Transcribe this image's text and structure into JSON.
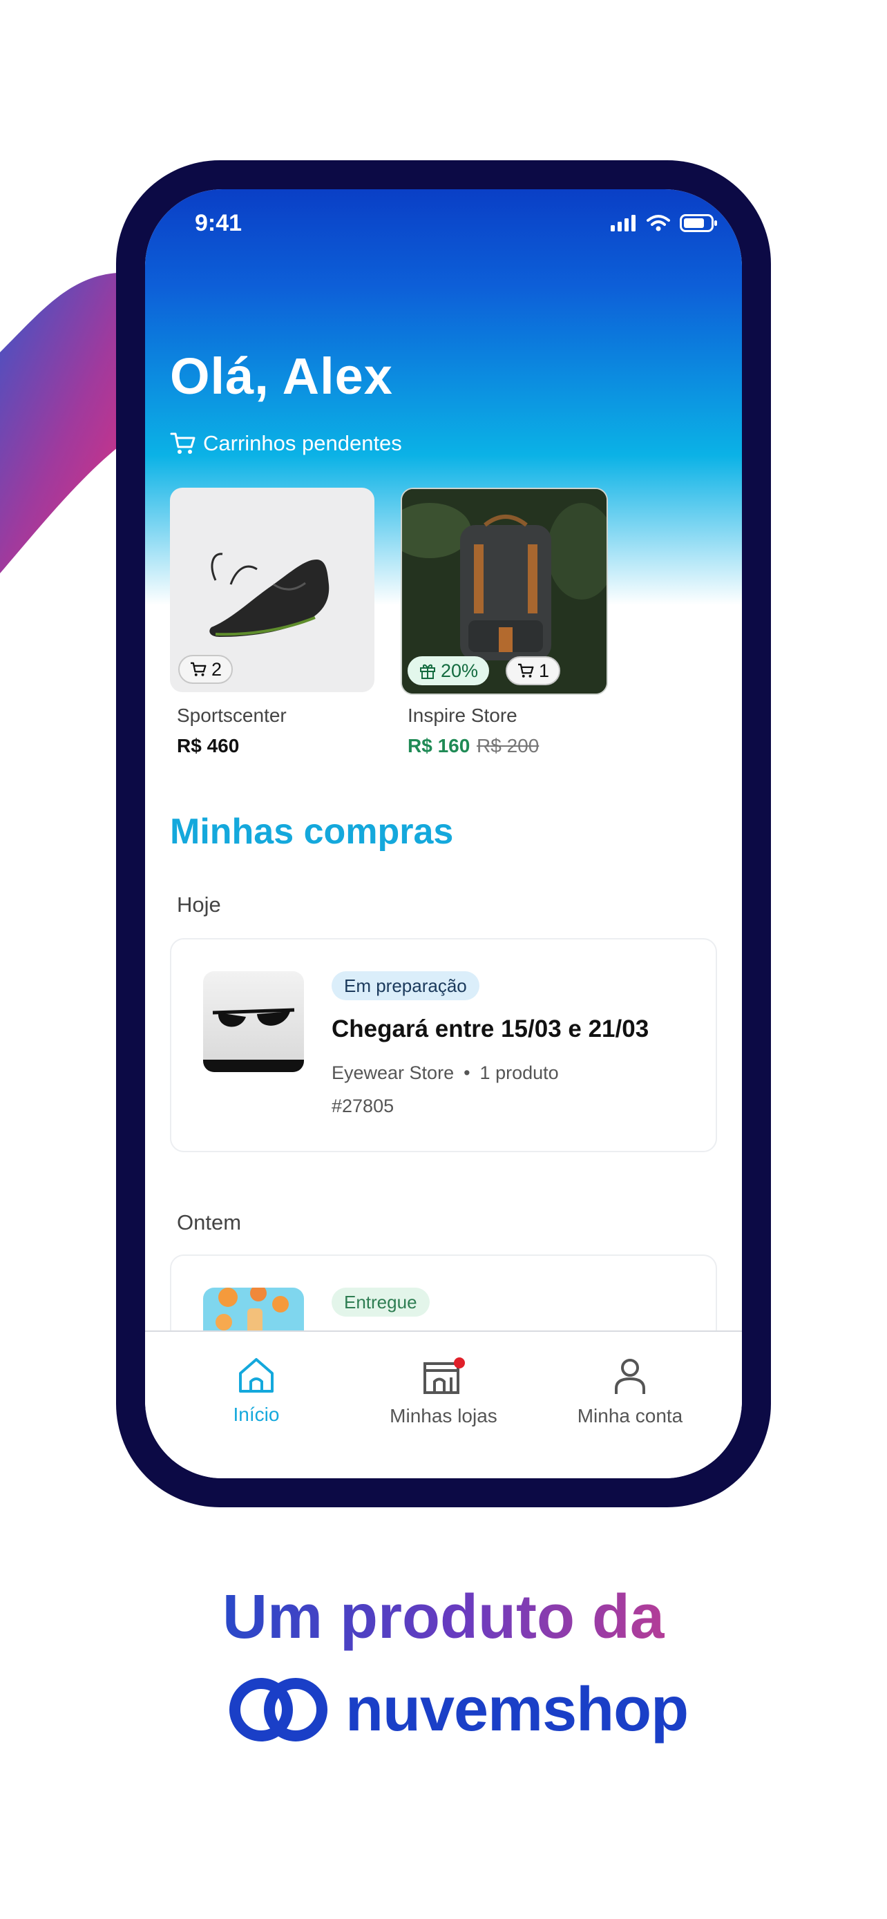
{
  "status_bar": {
    "time": "9:41"
  },
  "header": {
    "greeting": "Olá, Alex"
  },
  "pending_carts": {
    "title": "Carrinhos pendentes",
    "items": [
      {
        "store": "Sportscenter",
        "price": "R$ 460",
        "cart_count": "2"
      },
      {
        "store": "Inspire Store",
        "price": "R$ 160",
        "old_price": "R$ 200",
        "discount": "20%",
        "cart_count": "1"
      }
    ]
  },
  "purchases": {
    "title": "Minhas compras",
    "groups": [
      {
        "label": "Hoje",
        "order": {
          "status": "Em preparação",
          "title": "Chegará entre 15/03 e 21/03",
          "store": "Eyewear Store",
          "separator": "•",
          "products": "1 produto",
          "id": "#27805"
        }
      },
      {
        "label": "Ontem",
        "order": {
          "status": "Entregue"
        }
      }
    ]
  },
  "tabbar": {
    "tabs": [
      {
        "label": "Início",
        "active": true
      },
      {
        "label": "Minhas lojas",
        "notification": true
      },
      {
        "label": "Minha conta"
      }
    ]
  },
  "footer": {
    "tagline": "Um produto da",
    "brand": "nuvemshop"
  },
  "colors": {
    "accent": "#14a8dc",
    "brand_blue": "#1a3fc7",
    "promo_green": "#1f8a55",
    "phone_frame": "#0c0a45",
    "notification": "#e0202a"
  }
}
